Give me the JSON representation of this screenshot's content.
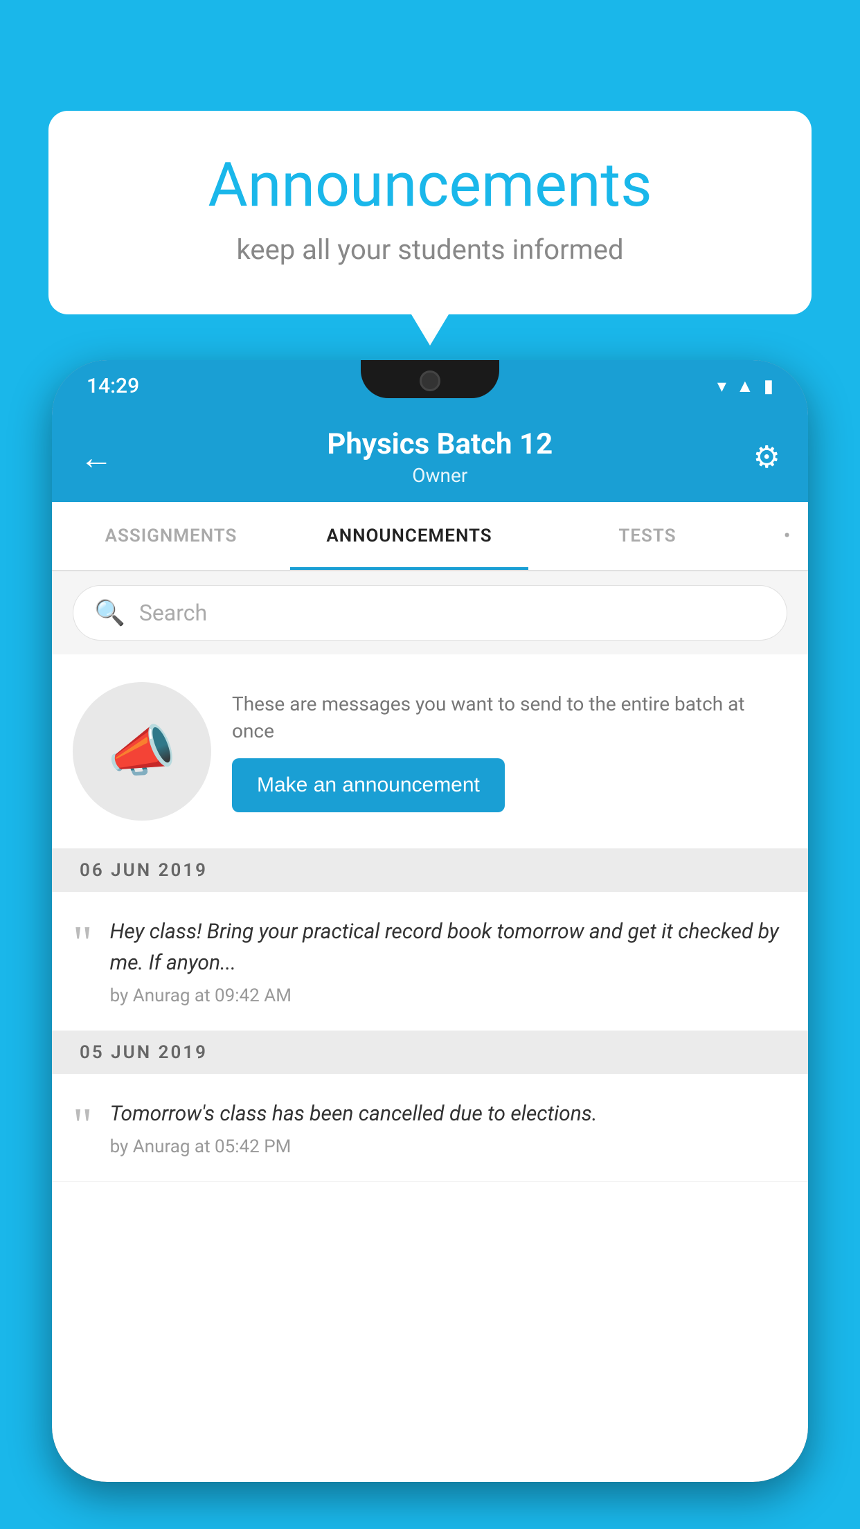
{
  "background_color": "#1ab7ea",
  "speech_bubble": {
    "title": "Announcements",
    "subtitle": "keep all your students informed"
  },
  "phone": {
    "status_bar": {
      "time": "14:29"
    },
    "app_bar": {
      "title": "Physics Batch 12",
      "subtitle": "Owner",
      "back_label": "←",
      "settings_label": "⚙"
    },
    "tabs": [
      {
        "label": "ASSIGNMENTS",
        "active": false
      },
      {
        "label": "ANNOUNCEMENTS",
        "active": true
      },
      {
        "label": "TESTS",
        "active": false
      },
      {
        "label": "•",
        "active": false
      }
    ],
    "search": {
      "placeholder": "Search"
    },
    "promo": {
      "description": "These are messages you want to send to the entire batch at once",
      "button_label": "Make an announcement"
    },
    "announcements": [
      {
        "date": "06  JUN  2019",
        "text": "Hey class! Bring your practical record book tomorrow and get it checked by me. If anyon...",
        "meta": "by Anurag at 09:42 AM"
      },
      {
        "date": "05  JUN  2019",
        "text": "Tomorrow's class has been cancelled due to elections.",
        "meta": "by Anurag at 05:42 PM"
      }
    ]
  }
}
